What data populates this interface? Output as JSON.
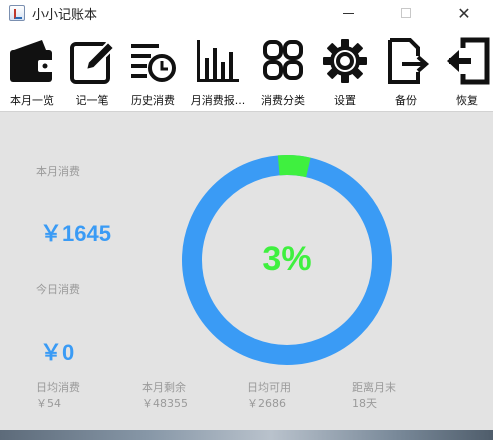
{
  "window": {
    "title": "小小记账本"
  },
  "toolbar": {
    "items": [
      {
        "label": "本月一览",
        "icon": "wallet-icon"
      },
      {
        "label": "记一笔",
        "icon": "edit-icon"
      },
      {
        "label": "历史消费",
        "icon": "history-icon"
      },
      {
        "label": "月消费报...",
        "icon": "bar-chart-icon"
      },
      {
        "label": "消费分类",
        "icon": "grid-icon"
      },
      {
        "label": "设置",
        "icon": "gear-icon"
      },
      {
        "label": "备份",
        "icon": "export-icon"
      },
      {
        "label": "恢复",
        "icon": "restore-icon"
      }
    ]
  },
  "overview": {
    "month_spend_label": "本月消费",
    "month_spend_value": "￥1645",
    "today_spend_label": "今日消费",
    "today_spend_value": "￥0",
    "percent_label": "3%",
    "percent_used": 0.03,
    "stats": [
      {
        "label": "日均消费",
        "value": "￥54"
      },
      {
        "label": "本月剩余",
        "value": "￥48355"
      },
      {
        "label": "日均可用",
        "value": "￥2686"
      },
      {
        "label": "距离月末",
        "value": "18天"
      }
    ]
  },
  "colors": {
    "ring": "#3a9bf5",
    "progress": "#3ff03f",
    "accent_text": "#3a9bf5"
  }
}
